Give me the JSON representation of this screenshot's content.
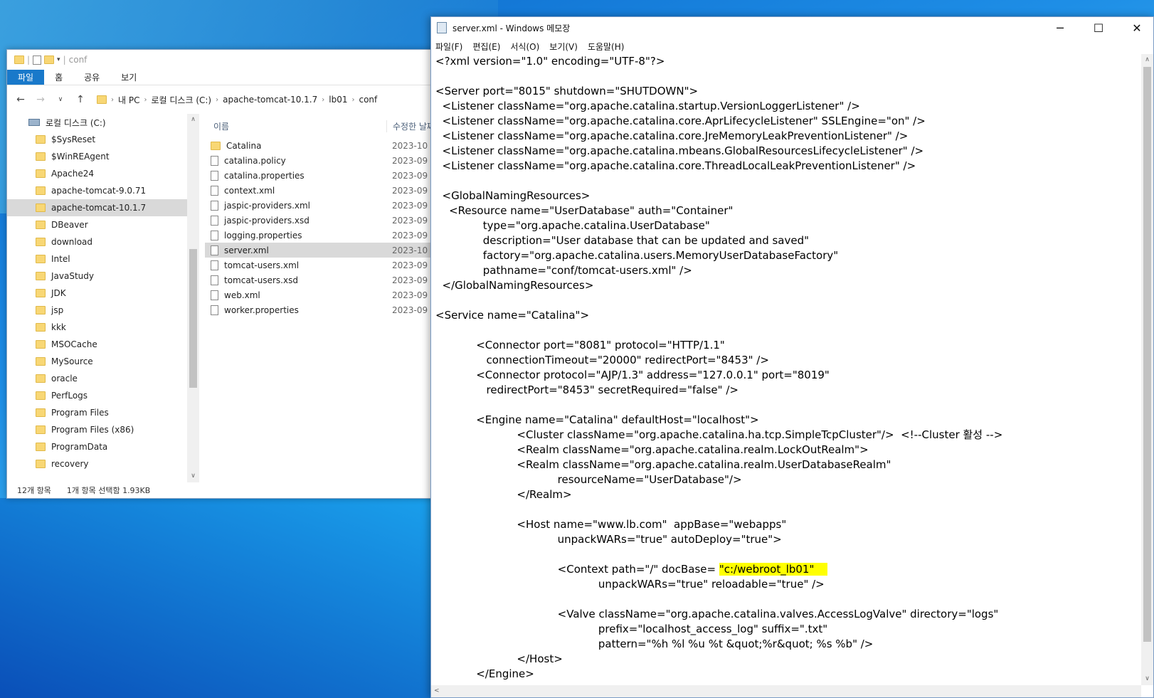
{
  "explorer": {
    "qat_path": "conf",
    "ribbon_tabs": [
      "파일",
      "홈",
      "공유",
      "보기"
    ],
    "breadcrumb": [
      "내 PC",
      "로컬 디스크 (C:)",
      "apache-tomcat-10.1.7",
      "lb01",
      "conf"
    ],
    "tree_root": "로컬 디스크 (C:)",
    "tree_items": [
      "$SysReset",
      "$WinREAgent",
      "Apache24",
      "apache-tomcat-9.0.71",
      "apache-tomcat-10.1.7",
      "DBeaver",
      "download",
      "Intel",
      "JavaStudy",
      "JDK",
      "jsp",
      "kkk",
      "MSOCache",
      "MySource",
      "oracle",
      "PerfLogs",
      "Program Files",
      "Program Files (x86)",
      "ProgramData",
      "recovery"
    ],
    "tree_selected": "apache-tomcat-10.1.7",
    "col_name": "이름",
    "col_date": "수정한 날짜",
    "files": [
      {
        "name": "Catalina",
        "date": "2023-10",
        "kind": "folder"
      },
      {
        "name": "catalina.policy",
        "date": "2023-09",
        "kind": "file"
      },
      {
        "name": "catalina.properties",
        "date": "2023-09",
        "kind": "file"
      },
      {
        "name": "context.xml",
        "date": "2023-09",
        "kind": "file"
      },
      {
        "name": "jaspic-providers.xml",
        "date": "2023-09",
        "kind": "file"
      },
      {
        "name": "jaspic-providers.xsd",
        "date": "2023-09",
        "kind": "file"
      },
      {
        "name": "logging.properties",
        "date": "2023-09",
        "kind": "file"
      },
      {
        "name": "server.xml",
        "date": "2023-10",
        "kind": "file",
        "selected": true
      },
      {
        "name": "tomcat-users.xml",
        "date": "2023-09",
        "kind": "file"
      },
      {
        "name": "tomcat-users.xsd",
        "date": "2023-09",
        "kind": "file"
      },
      {
        "name": "web.xml",
        "date": "2023-09",
        "kind": "file"
      },
      {
        "name": "worker.properties",
        "date": "2023-09",
        "kind": "file"
      }
    ],
    "status_count": "12개 항목",
    "status_selected": "1개 항목 선택함 1.93KB"
  },
  "notepad": {
    "title": "server.xml - Windows 메모장",
    "menu": [
      "파일(F)",
      "편집(E)",
      "서식(O)",
      "보기(V)",
      "도움말(H)"
    ],
    "highlight_color": "#ffff00",
    "lines_before": [
      "<?xml version=\"1.0\" encoding=\"UTF-8\"?>",
      "",
      "<Server port=\"8015\" shutdown=\"SHUTDOWN\">",
      "  <Listener className=\"org.apache.catalina.startup.VersionLoggerListener\" />",
      "  <Listener className=\"org.apache.catalina.core.AprLifecycleListener\" SSLEngine=\"on\" />",
      "  <Listener className=\"org.apache.catalina.core.JreMemoryLeakPreventionListener\" />",
      "  <Listener className=\"org.apache.catalina.mbeans.GlobalResourcesLifecycleListener\" />",
      "  <Listener className=\"org.apache.catalina.core.ThreadLocalLeakPreventionListener\" />",
      "",
      "  <GlobalNamingResources>",
      "    <Resource name=\"UserDatabase\" auth=\"Container\"",
      "              type=\"org.apache.catalina.UserDatabase\"",
      "              description=\"User database that can be updated and saved\"",
      "              factory=\"org.apache.catalina.users.MemoryUserDatabaseFactory\"",
      "              pathname=\"conf/tomcat-users.xml\" />",
      "  </GlobalNamingResources>",
      "",
      "<Service name=\"Catalina\">",
      "",
      "            <Connector port=\"8081\" protocol=\"HTTP/1.1\"",
      "               connectionTimeout=\"20000\" redirectPort=\"8453\" />",
      "            <Connector protocol=\"AJP/1.3\" address=\"127.0.0.1\" port=\"8019\"",
      "               redirectPort=\"8453\" secretRequired=\"false\" />",
      "",
      "            <Engine name=\"Catalina\" defaultHost=\"localhost\">",
      "                        <Cluster className=\"org.apache.catalina.ha.tcp.SimpleTcpCluster\"/>  <!--Cluster 활성 -->",
      "                        <Realm className=\"org.apache.catalina.realm.LockOutRealm\">",
      "                        <Realm className=\"org.apache.catalina.realm.UserDatabaseRealm\"",
      "                                    resourceName=\"UserDatabase\"/>",
      "                        </Realm>",
      "",
      "                        <Host name=\"www.lb.com\"  appBase=\"webapps\"",
      "                                    unpackWARs=\"true\" autoDeploy=\"true\">",
      ""
    ],
    "context_prefix": "                                    <Context path=\"/\" docBase= ",
    "context_highlight": "\"c:/webroot_lb01\"    ",
    "lines_after": [
      "                                                unpackWARs=\"true\" reloadable=\"true\" />",
      "",
      "                                    <Valve className=\"org.apache.catalina.valves.AccessLogValve\" directory=\"logs\"",
      "                                                prefix=\"localhost_access_log\" suffix=\".txt\"",
      "                                                pattern=\"%h %l %u %t &quot;%r&quot; %s %b\" />",
      "                        </Host>",
      "            </Engine>"
    ]
  }
}
